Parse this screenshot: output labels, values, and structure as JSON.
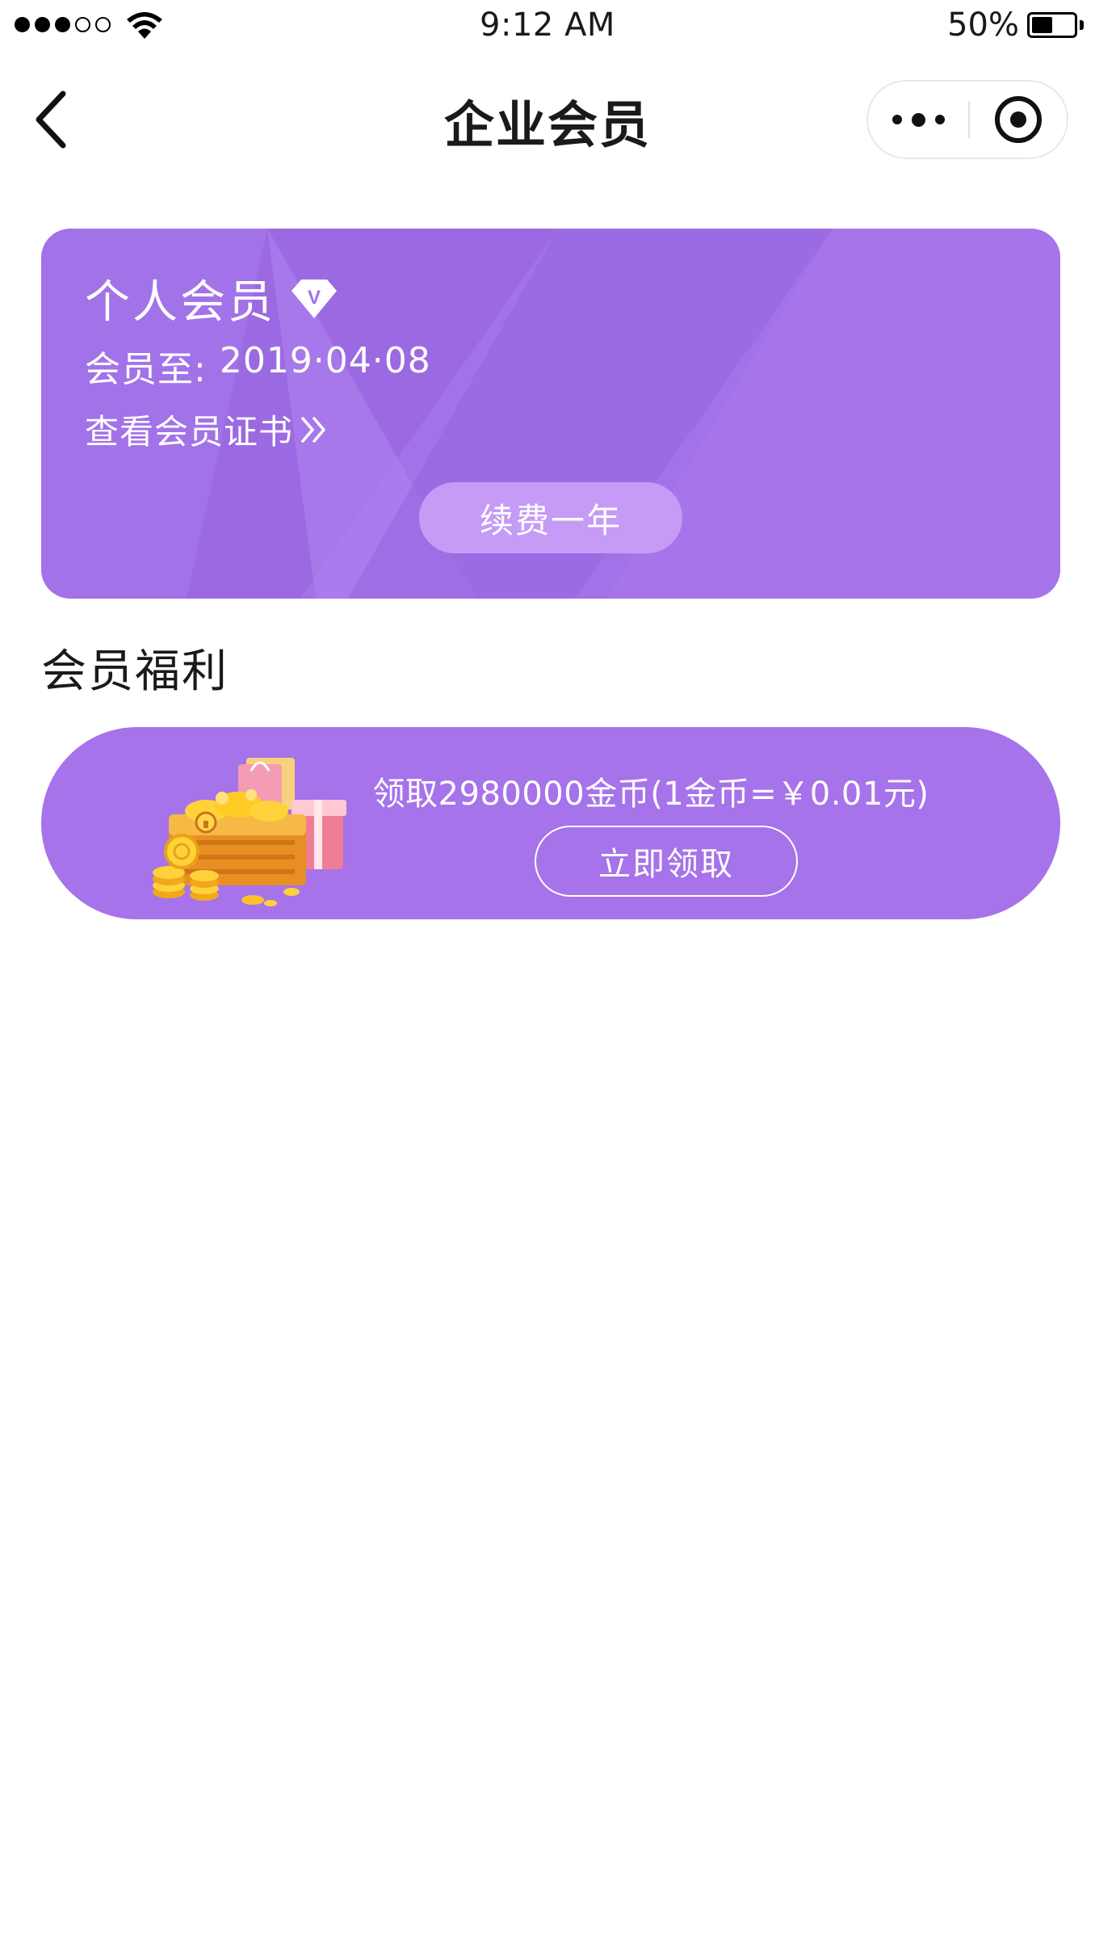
{
  "status_bar": {
    "signal_full_dots": 3,
    "signal_empty_dots": 2,
    "time": "9:12 AM",
    "battery_percent_text": "50%",
    "battery_level": 0.5
  },
  "nav": {
    "title": "企业会员",
    "icons": {
      "back": "chevron-left-icon",
      "more": "more-dots-icon",
      "close": "target-circle-icon"
    }
  },
  "member_card": {
    "title": "个人会员",
    "badge_icon": "vip-diamond-icon",
    "badge_letter": "V",
    "expire_label": "会员至:",
    "expire_date": "2019·04·08",
    "certificate_link": "查看会员证书",
    "renew_button": "续费一年",
    "colors": {
      "card": "#a272e8",
      "button": "#c59bf6"
    }
  },
  "benefits": {
    "section_title": "会员福利",
    "items": [
      {
        "icon": "treasure-chest-icon",
        "description": "领取2980000金币(1金币=￥0.01元)",
        "button": "立即领取"
      }
    ],
    "colors": {
      "card": "#a673ea"
    }
  }
}
